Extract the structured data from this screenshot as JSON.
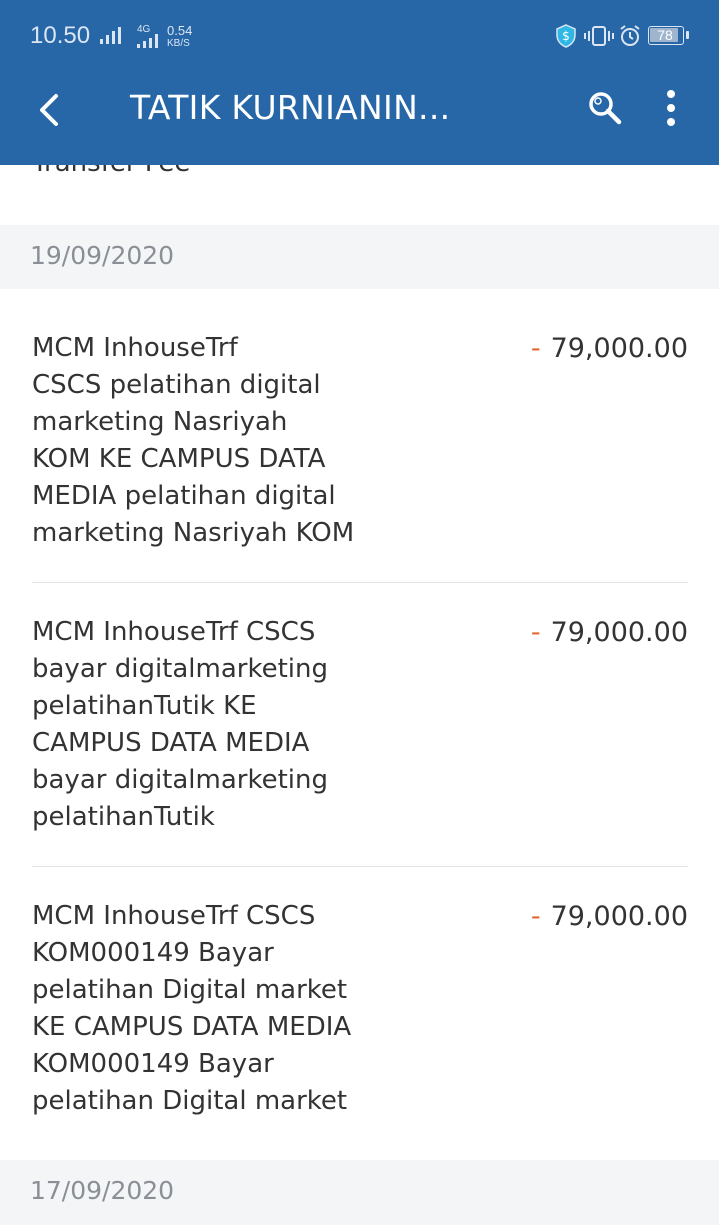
{
  "status_bar": {
    "time": "10.50",
    "network": "4G",
    "speed_value": "0.54",
    "speed_unit": "KB/S",
    "battery": "78"
  },
  "header": {
    "title": "TATIK KURNIANIN...",
    "icons": [
      "back-arrow-icon",
      "search-icon",
      "more-vert-icon"
    ]
  },
  "partial_item": {
    "label": "Transfer Fee"
  },
  "sections": [
    {
      "date": "19/09/2020",
      "transactions": [
        {
          "lines": [
            "MCM InhouseTrf",
            "CSCS pelatihan digital",
            "marketing Nasriyah",
            "KOM KE CAMPUS DATA",
            "MEDIA pelatihan digital",
            "marketing Nasriyah KOM"
          ],
          "sign": "-",
          "amount": "79,000.00"
        },
        {
          "lines": [
            "MCM InhouseTrf CSCS",
            "bayar digitalmarketing",
            "pelatihanTutik KE",
            "CAMPUS DATA MEDIA",
            "bayar digitalmarketing",
            "pelatihanTutik"
          ],
          "sign": "-",
          "amount": "79,000.00"
        },
        {
          "lines": [
            "MCM InhouseTrf CSCS",
            "KOM000149 Bayar",
            "pelatihan Digital market",
            "KE CAMPUS DATA MEDIA",
            "KOM000149 Bayar",
            "pelatihan Digital market"
          ],
          "sign": "-",
          "amount": "79,000.00"
        }
      ]
    },
    {
      "date": "17/09/2020",
      "transactions": []
    }
  ],
  "colors": {
    "header_bg": "#2767a8",
    "debit_sign": "#e8692f",
    "date_header_bg": "#f4f5f7"
  }
}
